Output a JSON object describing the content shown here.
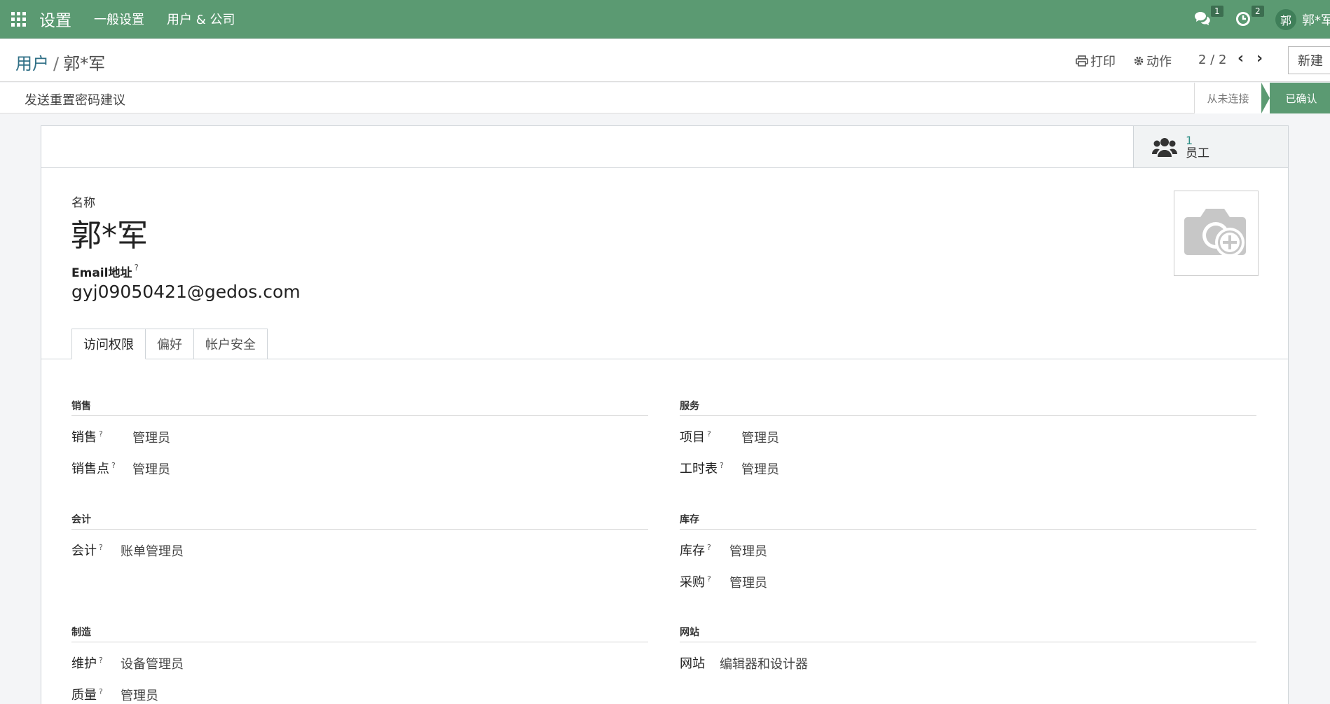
{
  "topbar": {
    "app_title": "设置",
    "menu": [
      "一般设置",
      "用户 & 公司"
    ],
    "messages_count": "1",
    "activities_count": "2",
    "avatar_initial": "郭",
    "user_name": "郭*军"
  },
  "control": {
    "breadcrumb_parent": "用户",
    "breadcrumb_current": "郭*军",
    "print_label": "打印",
    "action_label": "动作",
    "pager": "2 / 2",
    "new_label": "新建"
  },
  "statusbar": {
    "reset_password_label": "发送重置密码建议",
    "states": [
      "从未连接",
      "已确认"
    ],
    "active_state": "已确认"
  },
  "stat_button": {
    "value": "1",
    "label": "员工"
  },
  "form": {
    "name_label": "名称",
    "name_value": "郭*军",
    "email_label": "Email地址",
    "email_help": "?",
    "email_value": "gyj09050421@gedos.com",
    "tabs": [
      "访问权限",
      "偏好",
      "帐户安全"
    ],
    "active_tab": "访问权限"
  },
  "access": {
    "sales": {
      "title": "销售",
      "rows": [
        {
          "label": "销售",
          "value": "管理员"
        },
        {
          "label": "销售点",
          "value": "管理员"
        }
      ]
    },
    "services": {
      "title": "服务",
      "rows": [
        {
          "label": "项目",
          "value": "管理员"
        },
        {
          "label": "工时表",
          "value": "管理员"
        }
      ]
    },
    "accounting": {
      "title": "会计",
      "rows": [
        {
          "label": "会计",
          "value": "账单管理员"
        }
      ]
    },
    "inventory": {
      "title": "库存",
      "rows": [
        {
          "label": "库存",
          "value": "管理员"
        },
        {
          "label": "采购",
          "value": "管理员"
        }
      ]
    },
    "manufacturing": {
      "title": "制造",
      "rows": [
        {
          "label": "维护",
          "value": "设备管理员"
        },
        {
          "label": "质量",
          "value": "管理员"
        }
      ]
    },
    "website": {
      "title": "网站",
      "rows": [
        {
          "label": "网站",
          "value": "编辑器和设计器"
        }
      ]
    }
  },
  "colors": {
    "brand": "#5b9a72",
    "link": "#2f8f86"
  }
}
